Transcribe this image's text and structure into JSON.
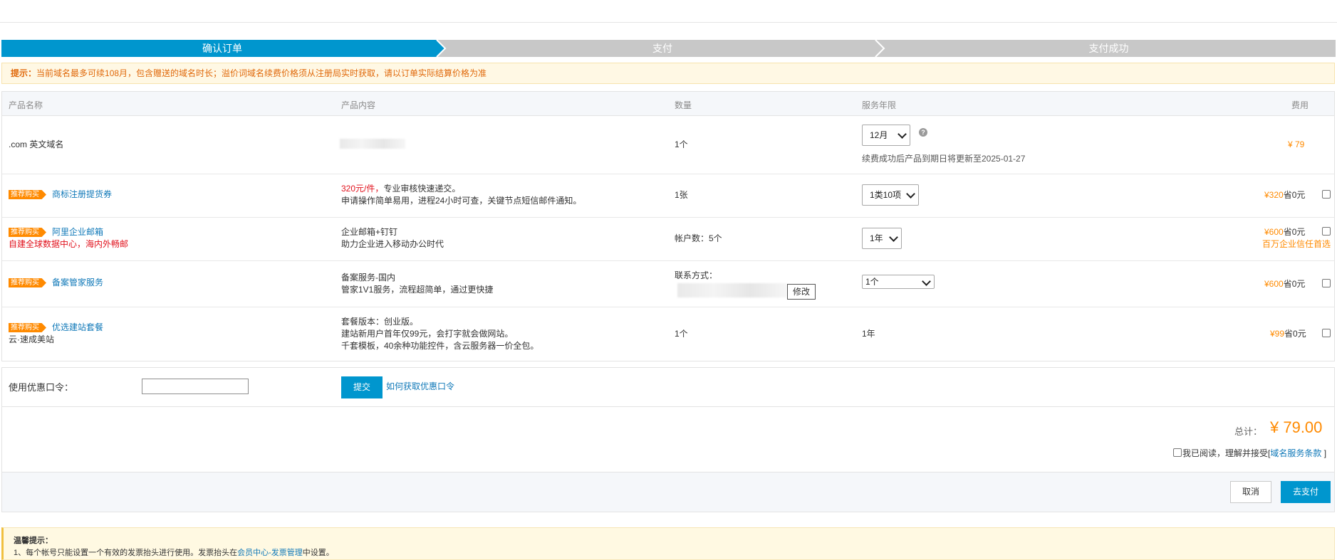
{
  "steps": [
    {
      "label": "确认订单",
      "color": "#0096ce"
    },
    {
      "label": "支付",
      "color": "#c8c8c8"
    },
    {
      "label": "支付成功",
      "color": "#c8c8c8"
    }
  ],
  "notice": {
    "prefix": "提示：",
    "text": "当前域名最多可续108月，包含赠送的域名时长；溢价词域名续费价格须从注册局实时获取，请以订单实际结算价格为准"
  },
  "table": {
    "headers": [
      "产品名称",
      "产品内容",
      "数量",
      "服务年限",
      "费用"
    ],
    "rows": [
      {
        "name": ".com 英文域名",
        "qty": "1个",
        "period": "12月",
        "period_note": "续费成功后产品到期日将更新至2025-01-27",
        "price": "¥ 79"
      },
      {
        "badge": "推荐购买",
        "name": "商标注册提货券",
        "content_highlight": "320元/件，",
        "content1": "专业审核快速递交。",
        "content2": "申请操作简单易用，进程24小时可查，关键节点短信邮件通知。",
        "qty": "1张",
        "period": "1类10项",
        "price": "¥320",
        "save": "省0元"
      },
      {
        "badge": "推荐购买",
        "name": "阿里企业邮箱",
        "subname": "自建全球数据中心，海内外畅邮",
        "content1": "企业邮箱+钉钉",
        "content2": "助力企业进入移动办公时代",
        "qty": "帐户数：5个",
        "period": "1年",
        "price": "¥600",
        "save": "省0元",
        "extra": "百万企业信任首选"
      },
      {
        "badge": "推荐购买",
        "name": "备案管家服务",
        "content1": "备案服务-国内",
        "content2": "管家1V1服务，流程超简单，通过更快捷",
        "qty": "联系方式：",
        "edit_label": "修改",
        "period": "1个",
        "price": "¥600",
        "save": "省0元"
      },
      {
        "badge": "推荐购买",
        "name": "优选建站套餐",
        "subname": "云·速成美站",
        "content1": "套餐版本：创业版。",
        "content2": "建站新用户首年仅99元，会打字就会做网站。",
        "content3": "千套模板，40余种功能控件，含云服务器一价全包。",
        "qty": "1个",
        "period": "1年",
        "price": "¥99",
        "save": "省0元"
      }
    ]
  },
  "coupon": {
    "label": "使用优惠口令：",
    "submit": "提交",
    "help_link": "如何获取优惠口令"
  },
  "total": {
    "label": "总计：",
    "amount": "¥ 79.00",
    "agree_text": "我已阅读，理解并接受[",
    "agree_link": "域名服务条款",
    "agree_close": "]"
  },
  "actions": {
    "cancel": "取消",
    "pay": "去支付"
  },
  "tips": {
    "title": "温馨提示：",
    "line1_pre": "1、每个帐号只能设置一个有效的发票抬头进行使用。发票抬头在",
    "line1_link": "会员中心-发票管理",
    "line1_post": "中设置。"
  },
  "colors": {
    "accent": "#0096ce",
    "price": "#ff8a00",
    "link": "#0f78b8",
    "warn": "#e1111c"
  }
}
